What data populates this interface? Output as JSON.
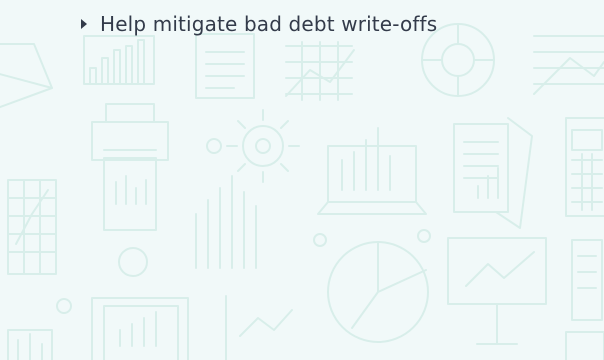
{
  "bullet": {
    "icon": "triangle-right-icon",
    "text": "Help mitigate bad debt write-offs"
  },
  "background": {
    "theme_color": "#d8eeea",
    "icons": [
      "pie-chart-icon",
      "bar-chart-icon",
      "document-icon",
      "line-chart-icon",
      "donut-chart-icon",
      "gear-icon",
      "printer-icon",
      "laptop-chart-icon",
      "report-icon",
      "calculator-icon",
      "grid-chart-icon",
      "analytics-icon"
    ]
  }
}
